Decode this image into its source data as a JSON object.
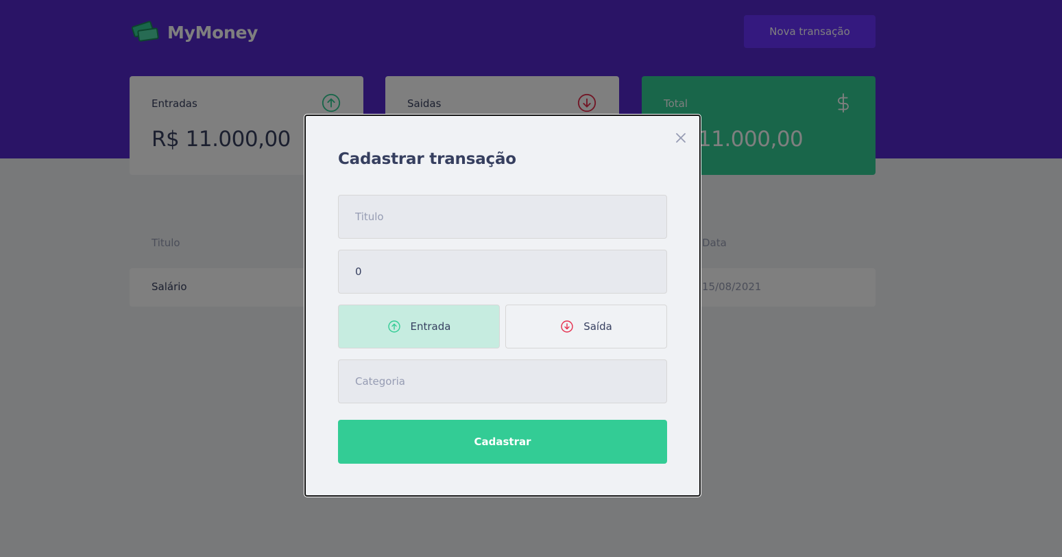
{
  "app": {
    "name": "MyMoney",
    "logo_icon": "money-bills-icon",
    "new_transaction_label": "Nova transação"
  },
  "colors": {
    "header": "#5429cc",
    "button": "#6933ff",
    "green": "#33cc95",
    "red": "#e52e4d",
    "background": "#f0f2f5",
    "text_title": "#363f5f",
    "text_body": "#969cb3"
  },
  "summary": {
    "income": {
      "label": "Entradas",
      "value": "R$ 11.000,00",
      "icon": "arrow-circle-up-icon"
    },
    "outcome": {
      "label": "Saidas",
      "value": "",
      "icon": "arrow-circle-down-icon"
    },
    "total": {
      "label": "Total",
      "value": "11.000,00",
      "icon": "dollar-sign-icon"
    }
  },
  "table": {
    "headers": [
      "Titulo",
      "Data"
    ],
    "rows": [
      {
        "title": "Salário",
        "date": "15/08/2021"
      }
    ]
  },
  "modal": {
    "title": "Cadastrar transação",
    "close_icon": "close-icon",
    "title_placeholder": "Titulo",
    "amount_value": "0",
    "type_income_label": "Entrada",
    "type_outcome_label": "Saída",
    "selected_type": "Entrada",
    "category_placeholder": "Categoria",
    "submit_label": "Cadastrar"
  }
}
